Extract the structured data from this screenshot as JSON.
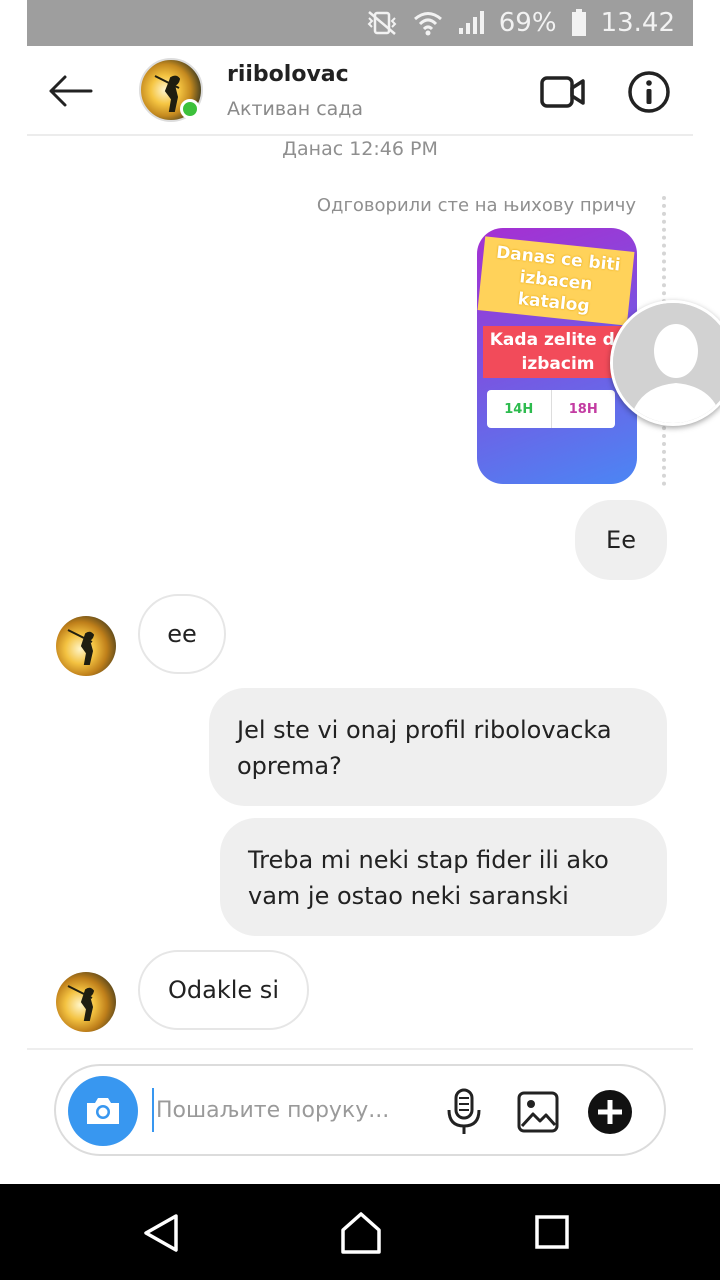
{
  "status_bar": {
    "battery_percent": "69%",
    "time": "13.42",
    "icons": [
      "vibrate-mute-icon",
      "wifi-icon",
      "signal-icon",
      "battery-icon"
    ]
  },
  "header": {
    "username": "riibolovac",
    "status": "Активан сада",
    "icons": [
      "back-arrow-icon",
      "video-call-icon",
      "info-icon"
    ]
  },
  "chat": {
    "timestamp": "Данас 12:46 PM",
    "story_reply_note": "Одговорили сте на њихову причу",
    "story": {
      "tag1": "Danas ce biti izbacen katalog",
      "tag2": "Kada zelite da izbacim",
      "poll_option_1": "14H",
      "poll_option_2": "18H"
    },
    "messages": [
      {
        "direction": "out",
        "text": "Ee"
      },
      {
        "direction": "in",
        "text": "ee"
      },
      {
        "direction": "out",
        "text": "Jel ste vi onaj profil ribolovacka oprema?"
      },
      {
        "direction": "out",
        "text": "Treba mi neki stap fider ili ako vam je ostao neki saranski"
      },
      {
        "direction": "in",
        "text": "Odakle si"
      }
    ]
  },
  "composer": {
    "placeholder": "Пошаљите поруку...",
    "value": "",
    "icons": [
      "camera-icon",
      "microphone-icon",
      "gallery-icon",
      "plus-icon"
    ]
  },
  "colors": {
    "accent": "#3897f0",
    "online": "#3cc13b",
    "out_bubble": "#efefef",
    "status_bar": "#9e9e9e"
  }
}
